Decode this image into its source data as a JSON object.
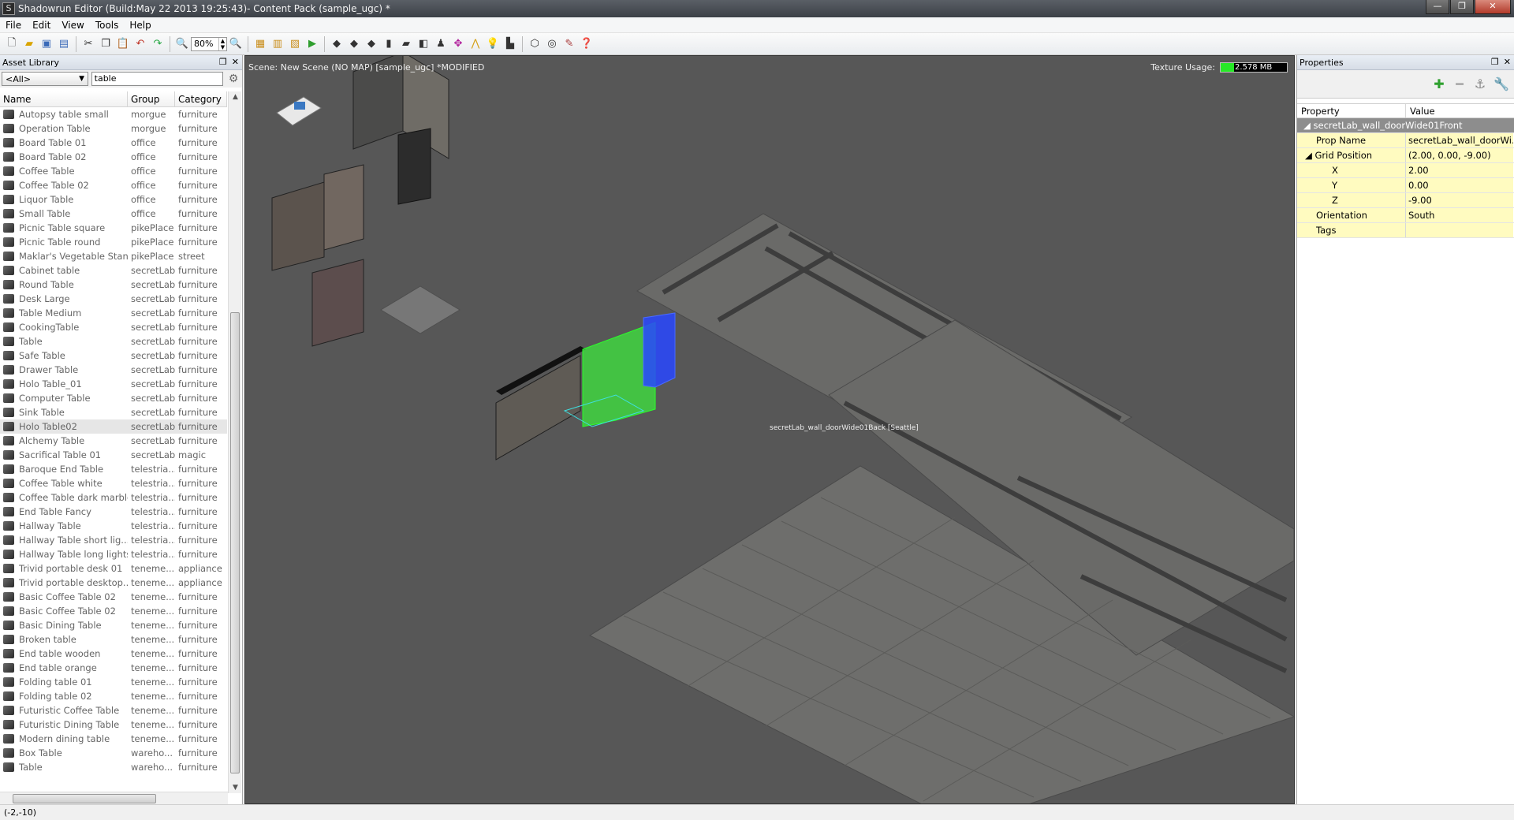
{
  "window": {
    "title": "Shadowrun Editor (Build:May 22 2013 19:25:43)- Content Pack (sample_ugc) *",
    "app_icon": "S",
    "minimize": "—",
    "maximize": "❐",
    "close": "✕"
  },
  "menu": [
    "File",
    "Edit",
    "View",
    "Tools",
    "Help"
  ],
  "toolbar": {
    "zoom_value": "80%"
  },
  "asset_library": {
    "title": "Asset Library",
    "filter_value": "<All>",
    "search_value": "table",
    "columns": [
      "Name",
      "Group",
      "Category"
    ],
    "rows": [
      {
        "name": "Autopsy table small",
        "group": "morgue",
        "category": "furniture"
      },
      {
        "name": "Operation Table",
        "group": "morgue",
        "category": "furniture"
      },
      {
        "name": "Board Table 01",
        "group": "office",
        "category": "furniture"
      },
      {
        "name": "Board Table 02",
        "group": "office",
        "category": "furniture"
      },
      {
        "name": "Coffee Table",
        "group": "office",
        "category": "furniture"
      },
      {
        "name": "Coffee Table 02",
        "group": "office",
        "category": "furniture"
      },
      {
        "name": "Liquor Table",
        "group": "office",
        "category": "furniture"
      },
      {
        "name": "Small Table",
        "group": "office",
        "category": "furniture"
      },
      {
        "name": "Picnic Table square",
        "group": "pikePlace",
        "category": "furniture"
      },
      {
        "name": "Picnic Table round",
        "group": "pikePlace",
        "category": "furniture"
      },
      {
        "name": "Maklar's Vegetable Stand",
        "group": "pikePlace",
        "category": "street"
      },
      {
        "name": "Cabinet table",
        "group": "secretLab",
        "category": "furniture"
      },
      {
        "name": "Round Table",
        "group": "secretLab",
        "category": "furniture"
      },
      {
        "name": "Desk Large",
        "group": "secretLab",
        "category": "furniture"
      },
      {
        "name": "Table Medium",
        "group": "secretLab",
        "category": "furniture"
      },
      {
        "name": "CookingTable",
        "group": "secretLab",
        "category": "furniture"
      },
      {
        "name": "Table",
        "group": "secretLab",
        "category": "furniture"
      },
      {
        "name": "Safe Table",
        "group": "secretLab",
        "category": "furniture"
      },
      {
        "name": "Drawer Table",
        "group": "secretLab",
        "category": "furniture"
      },
      {
        "name": "Holo Table_01",
        "group": "secretLab",
        "category": "furniture"
      },
      {
        "name": "Computer Table",
        "group": "secretLab",
        "category": "furniture"
      },
      {
        "name": "Sink Table",
        "group": "secretLab",
        "category": "furniture"
      },
      {
        "name": "Holo Table02",
        "group": "secretLab",
        "category": "furniture"
      },
      {
        "name": "Alchemy Table",
        "group": "secretLab",
        "category": "furniture"
      },
      {
        "name": "Sacrifical Table 01",
        "group": "secretLab",
        "category": "magic"
      },
      {
        "name": "Baroque End Table",
        "group": "telestria...",
        "category": "furniture"
      },
      {
        "name": "Coffee Table white",
        "group": "telestria...",
        "category": "furniture"
      },
      {
        "name": "Coffee Table dark marble",
        "group": "telestria...",
        "category": "furniture"
      },
      {
        "name": "End Table Fancy",
        "group": "telestria...",
        "category": "furniture"
      },
      {
        "name": "Hallway Table",
        "group": "telestria...",
        "category": "furniture"
      },
      {
        "name": "Hallway Table short lig...",
        "group": "telestria...",
        "category": "furniture"
      },
      {
        "name": "Hallway Table long lights",
        "group": "telestria...",
        "category": "furniture"
      },
      {
        "name": "Trivid portable desk 01",
        "group": "teneme...",
        "category": "appliance"
      },
      {
        "name": "Trivid portable desktop...",
        "group": "teneme...",
        "category": "appliance"
      },
      {
        "name": "Basic Coffee Table 02",
        "group": "teneme...",
        "category": "furniture"
      },
      {
        "name": "Basic Coffee Table 02",
        "group": "teneme...",
        "category": "furniture"
      },
      {
        "name": "Basic Dining Table",
        "group": "teneme...",
        "category": "furniture"
      },
      {
        "name": "Broken table",
        "group": "teneme...",
        "category": "furniture"
      },
      {
        "name": "End table wooden",
        "group": "teneme...",
        "category": "furniture"
      },
      {
        "name": "End table orange",
        "group": "teneme...",
        "category": "furniture"
      },
      {
        "name": "Folding table 01",
        "group": "teneme...",
        "category": "furniture"
      },
      {
        "name": "Folding table 02",
        "group": "teneme...",
        "category": "furniture"
      },
      {
        "name": "Futuristic Coffee Table",
        "group": "teneme...",
        "category": "furniture"
      },
      {
        "name": "Futuristic Dining Table",
        "group": "teneme...",
        "category": "furniture"
      },
      {
        "name": "Modern dining table",
        "group": "teneme...",
        "category": "furniture"
      },
      {
        "name": "Box Table",
        "group": "wareho...",
        "category": "furniture"
      },
      {
        "name": "Table",
        "group": "wareho...",
        "category": "furniture"
      }
    ],
    "selected_row": 22
  },
  "viewport": {
    "scene_label": "Scene: New Scene (NO MAP) [sample_ugc] *MODIFIED",
    "texture_label": "Texture Usage:",
    "texture_value": "2.578 MB",
    "texture_fill_fraction": 0.2,
    "selected_object_label": "secretLab_wall_doorWide01Back [Seattle]"
  },
  "properties": {
    "title": "Properties",
    "columns": [
      "Property",
      "Value"
    ],
    "category": "secretLab_wall_doorWide01Front",
    "rows": [
      {
        "name": "Prop Name",
        "value": "secretLab_wall_doorWi..."
      },
      {
        "name": "Grid Position",
        "value": "(2.00, 0.00, -9.00)"
      },
      {
        "name": "X",
        "value": "2.00"
      },
      {
        "name": "Y",
        "value": "0.00"
      },
      {
        "name": "Z",
        "value": "-9.00"
      },
      {
        "name": "Orientation",
        "value": "South"
      },
      {
        "name": "Tags",
        "value": ""
      }
    ]
  },
  "status": {
    "coords": "(-2,-10)"
  }
}
